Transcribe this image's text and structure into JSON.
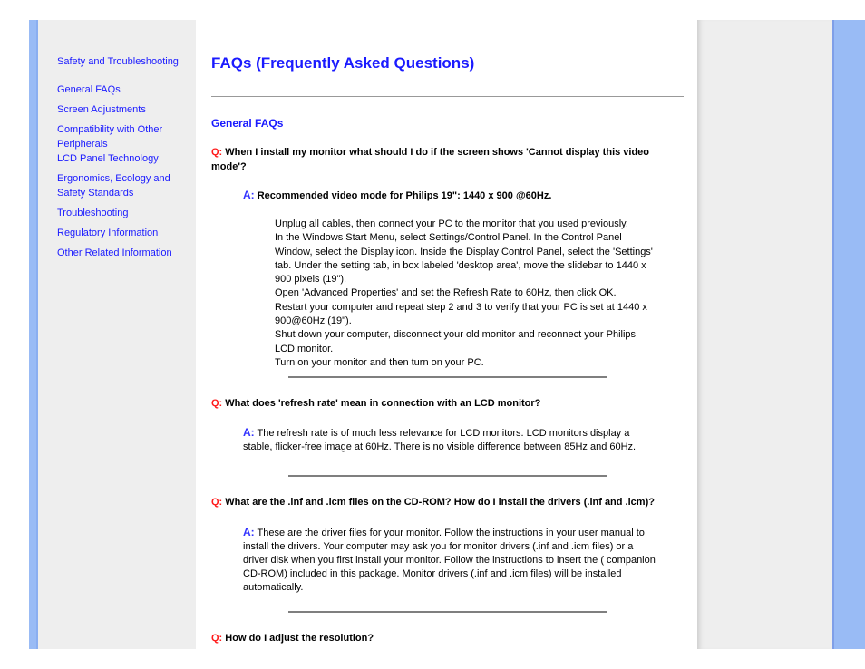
{
  "sidebar": {
    "items": [
      {
        "label": "Safety and Troubleshooting"
      },
      {
        "label": "General FAQs"
      },
      {
        "label": "Screen Adjustments"
      },
      {
        "label": "Compatibility with Other Peripherals"
      },
      {
        "label": "LCD Panel Technology"
      },
      {
        "label": "Ergonomics, Ecology and Safety Standards"
      },
      {
        "label": "Troubleshooting"
      },
      {
        "label": "Regulatory Information"
      },
      {
        "label": "Other Related Information"
      }
    ]
  },
  "main": {
    "title": "FAQs (Frequently Asked Questions)",
    "section": "General FAQs",
    "q_label": "Q:",
    "a_label": "A:",
    "faqs": [
      {
        "question": "When I install my monitor what should I do if the screen shows 'Cannot display this video mode'?",
        "answer": "Recommended video mode for Philips 19\": 1440 x 900 @60Hz.",
        "steps": [
          "Unplug all cables, then connect your PC to the monitor that you used previously.",
          "In the Windows Start Menu, select Settings/Control Panel. In the Control Panel Window, select the Display icon. Inside the Display Control Panel, select the 'Settings' tab. Under the setting tab, in box labeled 'desktop area', move the slidebar to 1440 x 900 pixels (19\").",
          "Open 'Advanced Properties' and set the Refresh Rate to 60Hz, then click OK.",
          "Restart your computer and repeat step 2 and 3 to verify that your PC is set at 1440 x 900@60Hz (19\").",
          "Shut down your computer, disconnect your old monitor and reconnect your Philips LCD monitor.",
          "Turn on your monitor and then turn on your PC."
        ]
      },
      {
        "question": "What does 'refresh rate' mean in connection with an LCD monitor?",
        "answer": "The refresh rate is of much less relevance for LCD monitors. LCD monitors display a stable, flicker-free image at 60Hz. There is no visible difference between 85Hz and 60Hz."
      },
      {
        "question": "What are the .inf and .icm files on the CD-ROM? How do I install the drivers (.inf and .icm)?",
        "answer": "These are the driver files for your monitor. Follow the instructions in your user manual to install the drivers. Your computer may ask you for monitor drivers (.inf and .icm files) or a driver disk when you first install your monitor. Follow the instructions to insert the ( companion CD-ROM) included in this package. Monitor drivers (.inf and .icm files) will be installed automatically."
      },
      {
        "question": "How do I adjust the resolution?"
      }
    ]
  }
}
